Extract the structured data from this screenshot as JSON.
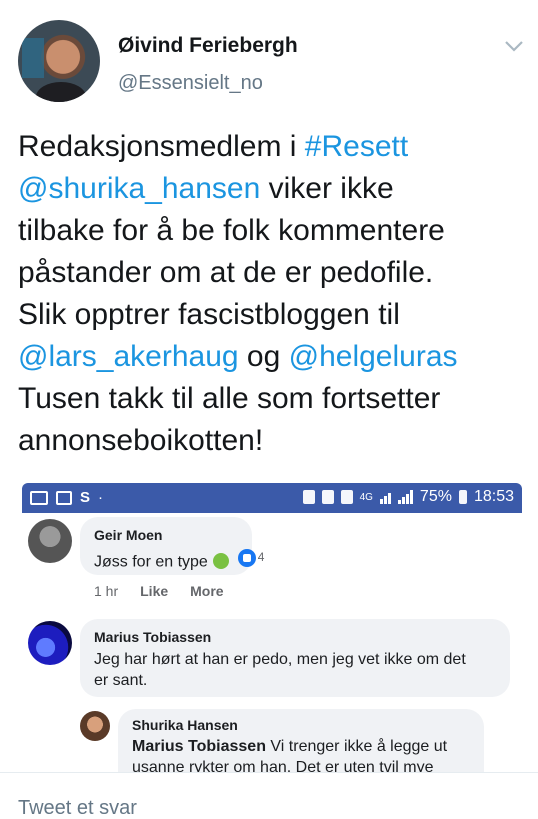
{
  "tweet": {
    "display_name": "Øivind Feriebergh",
    "handle": "@Essensielt_no",
    "lines": [
      [
        {
          "t": "Redaksjonsmedlem i ",
          "link": false
        },
        {
          "t": "#Resett",
          "link": true
        }
      ],
      [
        {
          "t": "@shurika_hansen",
          "link": true
        },
        {
          "t": " viker ikke",
          "link": false
        }
      ],
      [
        {
          "t": "tilbake for å be folk kommentere",
          "link": false
        }
      ],
      [
        {
          "t": "påstander om at de er pedofile.",
          "link": false
        }
      ],
      [
        {
          "t": "Slik opptrer fascistbloggen til",
          "link": false
        }
      ],
      [
        {
          "t": "@lars_akerhaug",
          "link": true
        },
        {
          "t": " og ",
          "link": false
        },
        {
          "t": "@helgeluras",
          "link": true
        }
      ],
      [
        {
          "t": "Tusen takk til alle som fortsetter",
          "link": false
        }
      ],
      [
        {
          "t": "annonseboikotten!",
          "link": false
        }
      ]
    ],
    "link_color": "#1b95e0"
  },
  "embed": {
    "statusbar": {
      "left_letter": "S",
      "dot": "·",
      "network": "4G",
      "battery": "75%",
      "time": "18:53",
      "color": "#3b5aa9"
    },
    "comments": [
      {
        "name": "Geir Moen",
        "text": "Jøss for en type",
        "reaction_count": "4",
        "time": "1 hr",
        "like_label": "Like",
        "more_label": "More"
      },
      {
        "name": "Marius Tobiassen",
        "text_line1": "Jeg har hørt at han er pedo, men jeg vet ikke om det",
        "text_line2": "er sant."
      },
      {
        "name": "Shurika Hansen",
        "mention": "Marius Tobiassen",
        "text_line1": " Vi trenger ikke å legge ut",
        "text_line2": "usanne rykter om han. Det er uten tvil mye"
      }
    ]
  },
  "reply": {
    "placeholder": "Tweet et svar"
  }
}
